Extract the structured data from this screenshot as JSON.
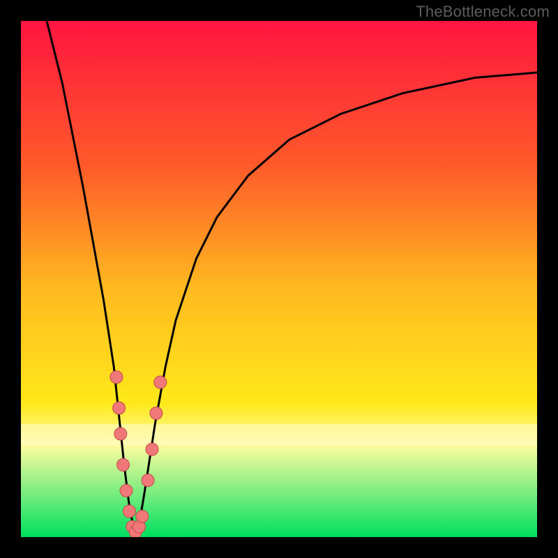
{
  "watermark": "TheBottleneck.com",
  "colors": {
    "frame": "#000000",
    "curve": "#000000",
    "dot_fill": "#f07878",
    "dot_stroke": "#c04a4a",
    "grad_top": "#ff1540",
    "grad_q1": "#ff5a2a",
    "grad_mid": "#ffba20",
    "grad_q3": "#ffe81a",
    "grad_band": "#fffca0",
    "grad_bot": "#00e060"
  },
  "chart_data": {
    "type": "line",
    "title": "",
    "xlabel": "",
    "ylabel": "",
    "xlim": [
      0,
      100
    ],
    "ylim": [
      0,
      100
    ],
    "x_min_at": 22,
    "series": [
      {
        "name": "bottleneck-curve",
        "x": [
          5,
          8,
          10,
          12,
          14,
          16,
          18,
          20,
          21,
          22,
          23,
          24,
          26,
          28,
          30,
          34,
          38,
          44,
          52,
          62,
          74,
          88,
          100
        ],
        "y": [
          100,
          88,
          78,
          68,
          57,
          46,
          33,
          14,
          6,
          1,
          3,
          9,
          22,
          33,
          42,
          54,
          62,
          70,
          77,
          82,
          86,
          89,
          90
        ]
      }
    ],
    "scatter": {
      "name": "highlight-points",
      "points": [
        {
          "x": 18.5,
          "y": 31
        },
        {
          "x": 19.0,
          "y": 25
        },
        {
          "x": 19.3,
          "y": 20
        },
        {
          "x": 19.8,
          "y": 14
        },
        {
          "x": 20.4,
          "y": 9
        },
        {
          "x": 21.0,
          "y": 5
        },
        {
          "x": 21.6,
          "y": 2
        },
        {
          "x": 22.2,
          "y": 1
        },
        {
          "x": 22.9,
          "y": 2
        },
        {
          "x": 23.5,
          "y": 4
        },
        {
          "x": 24.6,
          "y": 11
        },
        {
          "x": 25.4,
          "y": 17
        },
        {
          "x": 26.2,
          "y": 24
        },
        {
          "x": 27.0,
          "y": 30
        }
      ]
    }
  }
}
